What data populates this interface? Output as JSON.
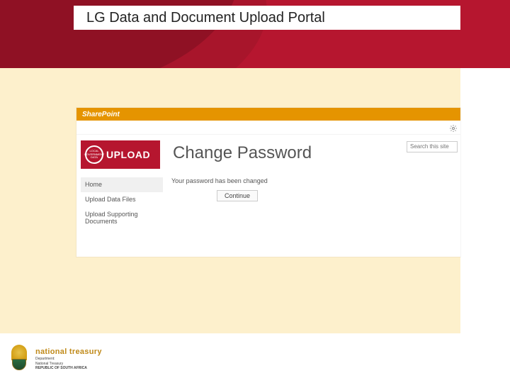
{
  "slide": {
    "title": "LG Data and Document Upload Portal"
  },
  "sharepoint": {
    "ribbon_label": "SharePoint",
    "logo": {
      "circle_top": "LOCAL",
      "circle_mid": "GOVERNMENT",
      "circle_bot": "DATA",
      "word": "UPLOAD"
    },
    "page_title": "Change Password",
    "search_placeholder": "Search this site",
    "nav": [
      {
        "label": "Home"
      },
      {
        "label": "Upload Data Files"
      },
      {
        "label": "Upload Supporting Documents"
      }
    ],
    "status_message": "Your password has been changed",
    "continue_label": "Continue"
  },
  "footer": {
    "org": "national treasury",
    "line1": "Department:",
    "line2": "National Treasury",
    "line3": "REPUBLIC OF SOUTH AFRICA"
  }
}
